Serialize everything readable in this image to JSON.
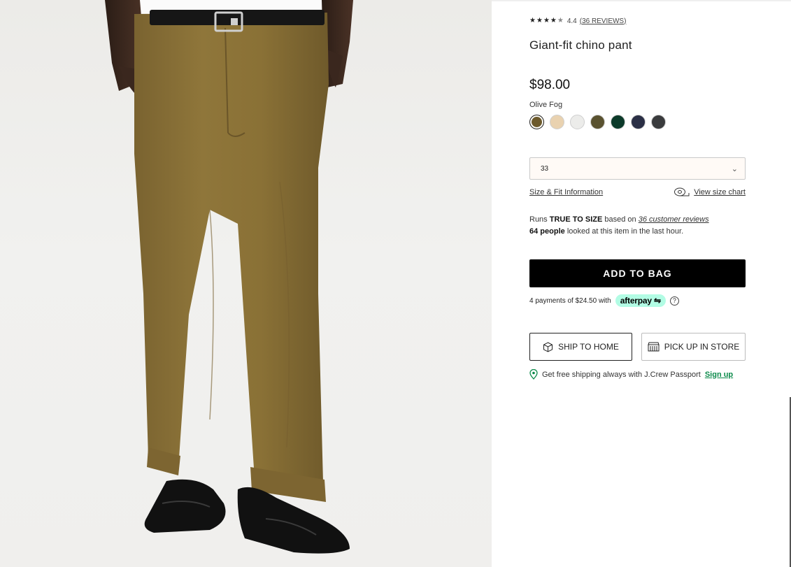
{
  "product": {
    "rating_value": "4.4",
    "reviews_link": "(36 REVIEWS)",
    "title": "Giant-fit chino pant",
    "price": "$98.00",
    "color_name": "Olive Fog",
    "swatch_colors": [
      "#6d5a2c",
      "#e9d2b0",
      "#ececea",
      "#5a5230",
      "#0c3a2a",
      "#2a2f45",
      "#3a3b3d"
    ],
    "rating_stars": 4.5
  },
  "size": {
    "selected": "33"
  },
  "fit": {
    "size_fit_link": "Size & Fit Information",
    "size_chart_link": "View size chart",
    "runs_prefix": "Runs",
    "true_to_size": "TRUE TO SIZE",
    "based_on": "based on",
    "customer_reviews": "36 customer reviews",
    "people_count": "64 people",
    "looked_text": "looked at this item in the last hour."
  },
  "actions": {
    "add_to_bag": "ADD TO BAG",
    "afterpay_text": "4 payments of $24.50 with",
    "afterpay_brand": "afterpay",
    "help_glyph": "?",
    "ship_to_home": "SHIP TO HOME",
    "pick_up_in_store": "PICK UP IN STORE"
  },
  "passport": {
    "text": "Get free shipping always with J.Crew Passport",
    "signup": "Sign up"
  },
  "icons": {
    "star": "star-icon",
    "chevron": "chevron-down-icon",
    "tape": "tape-measure-icon",
    "box": "box-icon",
    "store": "store-icon",
    "pin": "location-pin-icon",
    "afterpay": "afterpay-icon"
  },
  "colors": {
    "pant": "#8a7238",
    "accent_green": "#0b8a4a",
    "afterpay_mint": "#b2fce4"
  }
}
